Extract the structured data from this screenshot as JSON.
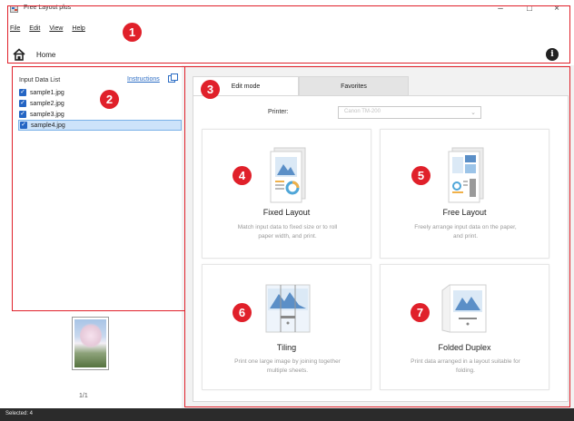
{
  "window": {
    "title": "Free Layout plus",
    "minimize_glyph": "–",
    "maximize_glyph": "□",
    "close_glyph": "×"
  },
  "menu": {
    "items": [
      "File",
      "Edit",
      "View",
      "Help"
    ]
  },
  "toolbar": {
    "home_label": "Home",
    "home_icon": "home-icon",
    "info_glyph": "i"
  },
  "left_panel": {
    "title": "Input Data List",
    "instructions_link": "Instructions",
    "files": [
      {
        "name": "sample1.jpg",
        "checked": true,
        "selected": false
      },
      {
        "name": "sample2.jpg",
        "checked": true,
        "selected": false
      },
      {
        "name": "sample3.jpg",
        "checked": true,
        "selected": false
      },
      {
        "name": "sample4.jpg",
        "checked": true,
        "selected": true
      }
    ],
    "check_glyph": "✓"
  },
  "preview": {
    "page_count": "1/1"
  },
  "tabs": [
    {
      "label": "Edit mode",
      "active": true
    },
    {
      "label": "Favorites",
      "active": false
    }
  ],
  "printer": {
    "label": "Printer:",
    "value": "Canon TM-200",
    "arrow_glyph": "⌄"
  },
  "modes": [
    {
      "title": "Fixed Layout",
      "desc_line1": "Match input data to fixed size or to roll",
      "desc_line2": "paper width, and print.",
      "icon": "fixed-layout-icon"
    },
    {
      "title": "Free Layout",
      "desc_line1": "Freely arrange input data on the paper,",
      "desc_line2": "and print.",
      "icon": "free-layout-icon"
    },
    {
      "title": "Tiling",
      "desc_line1": "Print one large image by joining together",
      "desc_line2": "multiple sheets.",
      "icon": "tiling-icon"
    },
    {
      "title": "Folded Duplex",
      "desc_line1": "Print data arranged in a layout suitable for",
      "desc_line2": "folding.",
      "icon": "folded-duplex-icon"
    }
  ],
  "callouts": [
    "1",
    "2",
    "3",
    "4",
    "5",
    "6",
    "7"
  ],
  "status": {
    "text": "Selected: 4"
  },
  "colors": {
    "callout_red": "#e0202a",
    "link_blue": "#2b6cc4",
    "checkbox_blue": "#2465c4",
    "selection_bg": "#cde3fa",
    "status_bar": "#2b2b2b"
  }
}
